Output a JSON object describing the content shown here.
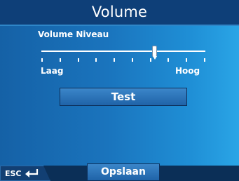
{
  "header": {
    "title": "Volume"
  },
  "volume": {
    "label": "Volume Niveau",
    "low_label": "Laag",
    "high_label": "Hoog",
    "level": 0.69
  },
  "buttons": {
    "test_label": "Test",
    "save_label": "Opslaan",
    "esc_label": "ESC"
  },
  "icons": {
    "esc": "return-arrow-icon"
  },
  "colors": {
    "title_bar": "#0e3f78",
    "background_left": "#1561a6",
    "background_right": "#2aa5e6",
    "button": "#2a72b8",
    "text": "#ffffff"
  }
}
